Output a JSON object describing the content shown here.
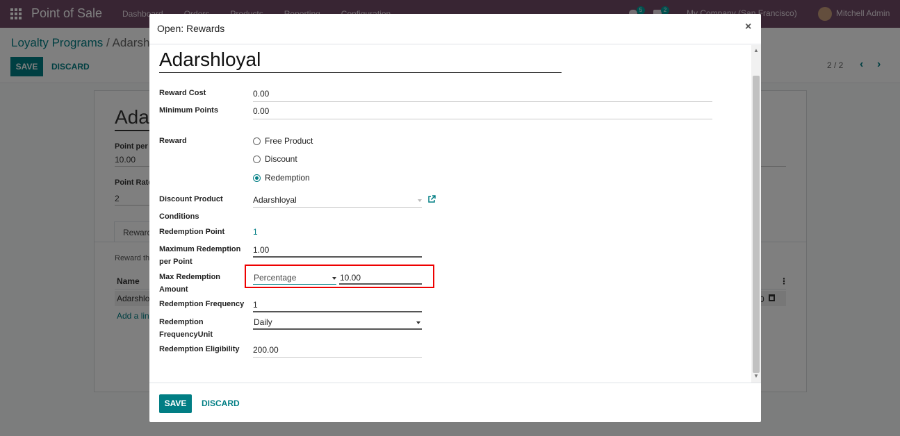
{
  "topbar": {
    "app_name": "Point of Sale",
    "menu": [
      "Dashboard",
      "Orders",
      "Products",
      "Reporting",
      "Configuration"
    ],
    "chat_count": "5",
    "activity_count": "2",
    "company": "My Company (San Francisco)",
    "user": "Mitchell Admin"
  },
  "control_panel": {
    "breadcrumb_parent": "Loyalty Programs",
    "breadcrumb_sep": "/",
    "breadcrumb_current": "Adarsh",
    "save_label": "SAVE",
    "discard_label": "DISCARD",
    "pager": "2 / 2"
  },
  "sheet": {
    "title": "Adar",
    "field1_label": "Point per",
    "field1_value": "10.00",
    "field2_label": "Point Rate",
    "field2_value": "2",
    "tab_label": "Reward",
    "reward_text": "Reward th",
    "col_name": "Name",
    "row_name": "Adarshlo",
    "row_end": "0",
    "add_line": "Add a line"
  },
  "modal": {
    "title": "Open: Rewards",
    "close_glyph": "×",
    "record_name": "Adarshloyal",
    "fields": {
      "reward_cost_label": "Reward Cost",
      "reward_cost_value": "0.00",
      "min_points_label": "Minimum Points",
      "min_points_value": "0.00",
      "reward_label": "Reward",
      "reward_options": [
        "Free Product",
        "Discount",
        "Redemption"
      ],
      "reward_selected": "Redemption",
      "discount_product_label": "Discount Product",
      "discount_product_value": "Adarshloyal",
      "conditions_label": "Conditions",
      "redemption_point_label": "Redemption Point",
      "redemption_point_value": "1",
      "max_redemption_per_point_label_1": "Maximum Redemption",
      "max_redemption_per_point_label_2": "per Point",
      "max_redemption_per_point_value": "1.00",
      "max_redemption_amount_label_1": "Max Redemption",
      "max_redemption_amount_label_2": "Amount",
      "max_redemption_amount_type": "Percentage",
      "max_redemption_amount_value": "10.00",
      "redemption_frequency_label": "Redemption Frequency",
      "redemption_frequency_value": "1",
      "redemption_frequency_unit_label_1": "Redemption",
      "redemption_frequency_unit_label_2": "FrequencyUnit",
      "redemption_frequency_unit_value": "Daily",
      "redemption_eligibility_label": "Redemption Eligibility",
      "redemption_eligibility_value": "200.00"
    },
    "footer": {
      "save_label": "SAVE",
      "discard_label": "DISCARD"
    },
    "highlight_color": "#e00000"
  },
  "colors": {
    "brand": "#714b67",
    "accent": "#017e84"
  },
  "icons": [
    "apps-grid-icon",
    "chat-icon",
    "activity-icon",
    "chevron-left-icon",
    "chevron-right-icon",
    "close-icon",
    "external-link-icon",
    "caret-down-icon",
    "kebab-icon",
    "trash-icon"
  ]
}
